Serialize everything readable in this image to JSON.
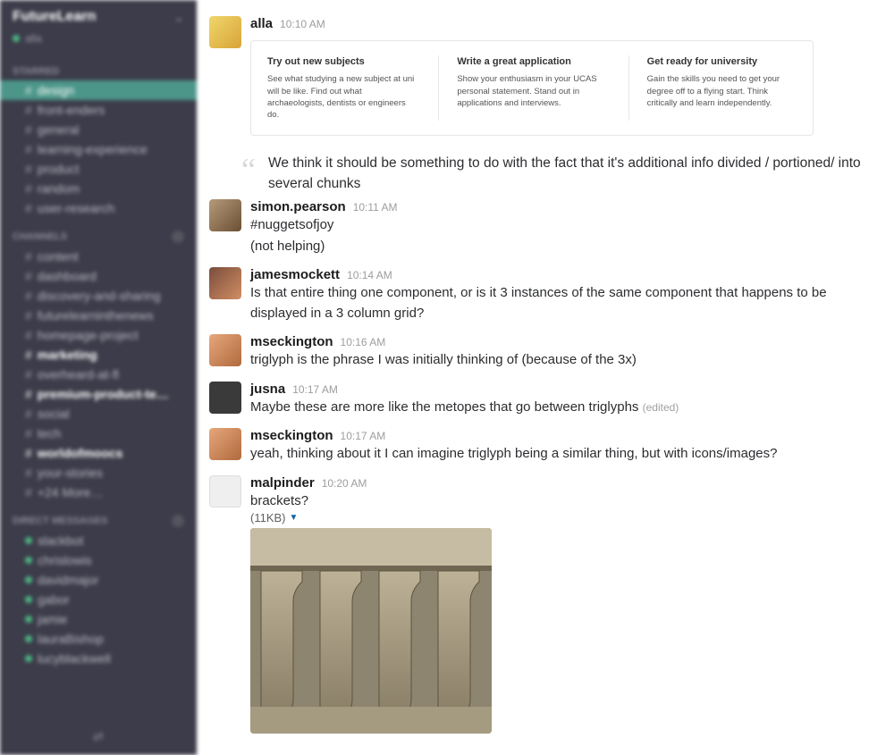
{
  "workspace": {
    "name": "FutureLearn",
    "user": "alla"
  },
  "sidebar": {
    "starred_label": "STARRED",
    "channels_label": "CHANNELS",
    "dm_label": "DIRECT MESSAGES",
    "starred": [
      {
        "label": "design",
        "active": true
      },
      {
        "label": "front-enders"
      },
      {
        "label": "general"
      },
      {
        "label": "learning-experience"
      },
      {
        "label": "product"
      },
      {
        "label": "random"
      },
      {
        "label": "user-research"
      }
    ],
    "channels": [
      {
        "label": "content"
      },
      {
        "label": "dashboard"
      },
      {
        "label": "discovery-and-sharing"
      },
      {
        "label": "futurelearninthenews"
      },
      {
        "label": "homepage-project"
      },
      {
        "label": "marketing",
        "bold": true
      },
      {
        "label": "overheard-at-fl"
      },
      {
        "label": "premium-product-te…",
        "bold": true
      },
      {
        "label": "social"
      },
      {
        "label": "tech"
      },
      {
        "label": "worldofmoocs",
        "bold": true
      },
      {
        "label": "your-stories"
      },
      {
        "label": "+24 More…"
      }
    ],
    "dms": [
      {
        "label": "slackbot"
      },
      {
        "label": "chrislowis"
      },
      {
        "label": "davidmajor"
      },
      {
        "label": "gabor"
      },
      {
        "label": "jamie"
      },
      {
        "label": "lauraBishop"
      },
      {
        "label": "lucyblackwell"
      }
    ]
  },
  "card": {
    "cols": [
      {
        "title": "Try out\nnew subjects",
        "body": "See what studying a new subject at uni will be like. Find out what archaeologists, dentists or engineers do."
      },
      {
        "title": "Write a great\napplication",
        "body": "Show your enthusiasm in your UCAS personal statement. Stand out in applications and interviews."
      },
      {
        "title": "Get ready for\nuniversity",
        "body": "Gain the skills you need to get your degree off to a flying start. Think critically and learn independently."
      }
    ]
  },
  "quote": "We think it should be something to do with the fact that it's additional info divided / portioned/ into several  chunks",
  "messages": [
    {
      "sender": "alla",
      "time": "10:10 AM"
    },
    {
      "sender": "simon.pearson",
      "time": "10:11 AM",
      "lines": [
        "#nuggetsofjoy",
        "(not helping)"
      ]
    },
    {
      "sender": "jamesmockett",
      "time": "10:14 AM",
      "lines": [
        "Is that entire thing one component, or is it 3 instances of the same component that happens to be displayed in a 3 column grid?"
      ]
    },
    {
      "sender": "mseckington",
      "time": "10:16 AM",
      "lines": [
        "triglyph is the phrase I was initially thinking of (because of the 3x)"
      ]
    },
    {
      "sender": "jusna",
      "time": "10:17 AM",
      "lines": [
        "Maybe these are more like the metopes that go between triglyphs"
      ],
      "edited": "(edited)"
    },
    {
      "sender": "mseckington",
      "time": "10:17 AM",
      "lines": [
        "yeah, thinking about it I can imagine triglyph being a similar thing, but with icons/images?"
      ]
    },
    {
      "sender": "malpinder",
      "time": "10:20 AM",
      "lines": [
        "brackets?"
      ],
      "fileSize": "(11KB)"
    }
  ]
}
